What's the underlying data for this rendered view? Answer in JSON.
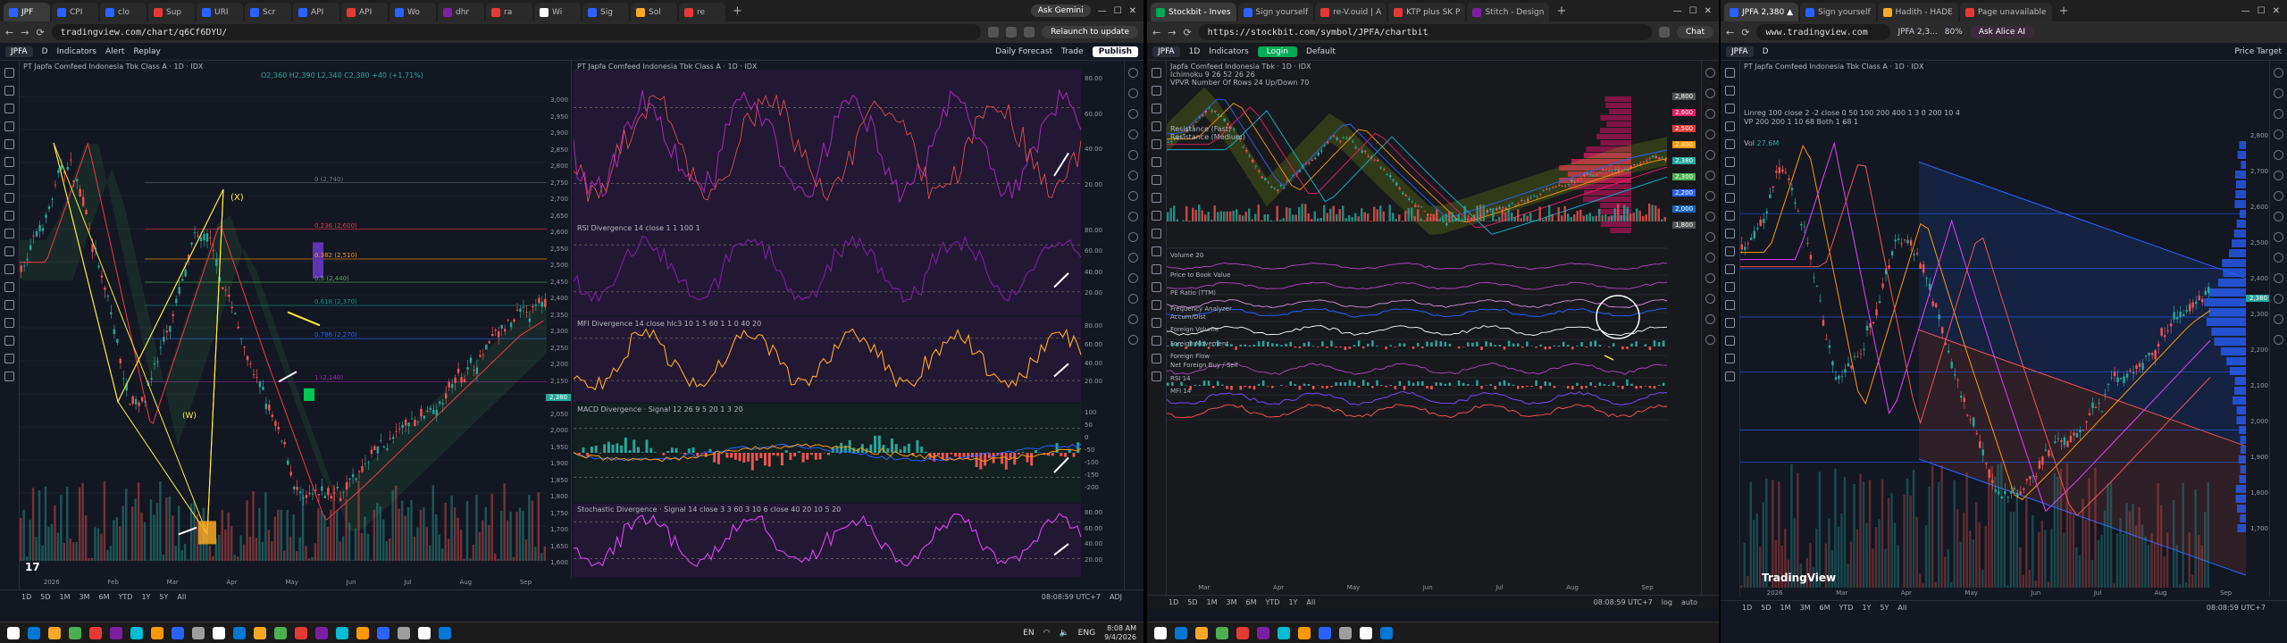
{
  "win1": {
    "tabs": [
      {
        "label": "JPF",
        "color": "#2962ff"
      },
      {
        "label": "CPI",
        "color": "#2962ff"
      },
      {
        "label": "clo",
        "color": "#2962ff"
      },
      {
        "label": "Sup",
        "color": "#e53935"
      },
      {
        "label": "URI",
        "color": "#2962ff"
      },
      {
        "label": "Scr",
        "color": "#2962ff"
      },
      {
        "label": "API",
        "color": "#2962ff"
      },
      {
        "label": "API",
        "color": "#e53935"
      },
      {
        "label": "Wo",
        "color": "#2962ff"
      },
      {
        "label": "dhr",
        "color": "#7b1fa2"
      },
      {
        "label": "ra",
        "color": "#e53935"
      },
      {
        "label": "Wi",
        "color": "#ffffff"
      },
      {
        "label": "Sig",
        "color": "#2962ff"
      },
      {
        "label": "Sol",
        "color": "#f9a825"
      },
      {
        "label": "re",
        "color": "#e53935"
      }
    ],
    "ask_gemini": "Ask Gemini",
    "url": "tradingview.com/chart/q6Cf6DYU/",
    "relaunch": "Relaunch to update",
    "symbol": "JPFA",
    "indicators": "Indicators",
    "alert": "Alert",
    "replay": "Replay",
    "daily_forecast": "Daily Forecast",
    "trade": "Trade",
    "publish": "Publish",
    "main_title": "PT Japfa Comfeed Indonesia Tbk Class A · 1D · IDX",
    "main_ohlc": "O2,360 H2,390 L2,340 C2,380 +40 (+1.71%)",
    "pane_title": "PT Japfa Comfeed Indonesia Tbk Class A · 1D · IDX",
    "rsi_div": "RSI Divergence 14 close 1 1 100 1",
    "mfi_div": "MFI Divergence 14 close hlc3 10 1 5 60 1 1 0 40 20",
    "macd_div": "MACD Divergence · Signal 12 26 9 5 20 1 3 20",
    "stoch_div": "Stochastic Divergence · Signal 14 close 3 3 60 3 10 6 close 40 20 10 5 20",
    "main_axis": [
      "3,000",
      "2,950",
      "2,900",
      "2,850",
      "2,800",
      "2,750",
      "2,700",
      "2,650",
      "2,600",
      "2,550",
      "2,500",
      "2,450",
      "2,400",
      "2,350",
      "2,300",
      "2,250",
      "2,200",
      "2,150",
      "2,100",
      "2,050",
      "2,000",
      "1,950",
      "1,900",
      "1,850",
      "1,800",
      "1,750",
      "1,700",
      "1,650",
      "1,600"
    ],
    "osc_axis": [
      "80.00",
      "60.00",
      "40.00",
      "20.00"
    ],
    "macd_axis": [
      "100",
      "50",
      "0",
      "-50",
      "-100",
      "-150",
      "-200"
    ],
    "months": [
      "2026",
      "Feb",
      "Mar",
      "Apr",
      "May",
      "Jun",
      "Jul",
      "Aug",
      "Sep"
    ],
    "fib_labels": [
      "0 (2,740)",
      "0.236 (2,600)",
      "0.382 (2,510)",
      "0.5 (2,440)",
      "0.618 (2,370)",
      "0.786 (2,270)",
      "1 (2,140)"
    ],
    "wave_labels": [
      "(X)",
      "(W)"
    ],
    "ranges": [
      "1D",
      "5D",
      "1M",
      "3M",
      "6M",
      "YTD",
      "1Y",
      "5Y",
      "All"
    ],
    "time_status": "08:08:59 UTC+7",
    "adj": "ADJ",
    "tv_logo": "TradingView"
  },
  "win2": {
    "tabs": [
      {
        "label": "Stockbit - Inves",
        "color": "#00ab55"
      },
      {
        "label": "Sign yourself",
        "color": "#2962ff"
      },
      {
        "label": "re-V.ouid | A",
        "color": "#e53935"
      },
      {
        "label": "KTP plus SK P",
        "color": "#e53935"
      },
      {
        "label": "Stitch - Design",
        "color": "#7b1fa2"
      }
    ],
    "url": "https://stockbit.com/symbol/JPFA/chartbit",
    "chat": "Chat",
    "symbol": "JPFA",
    "indicators": "Indicators",
    "login": "Login",
    "default": "Default",
    "chart_title": "Japfa Comfeed Indonesia Tbk · 1D · IDX",
    "ichimoku": "Ichimoku 9 26 52 26 26",
    "vpvr": "VPVR Number Of Rows 24 Up/Down 70",
    "indicators_list": [
      "Volume 20",
      "Price to Book Value",
      "PE Ratio (TTM)",
      "Frequency Analyzer",
      "Accum/Dist",
      "Foreign Volume",
      "Foreign Movement",
      "Foreign Flow",
      "Net Foreign Buy / Sell",
      "RSI 14",
      "MFI 14"
    ],
    "overlays": [
      "Resistance (Fast)",
      "Resistance (Medium)"
    ],
    "price_tags": [
      "2,800",
      "2,600",
      "2,500",
      "2,400",
      "2,380",
      "2,300",
      "2,200",
      "2,000",
      "1,800"
    ],
    "months": [
      "Mar",
      "Apr",
      "May",
      "Jun",
      "Jul",
      "Aug",
      "Sep"
    ],
    "ranges": [
      "1D",
      "5D",
      "1M",
      "3M",
      "6M",
      "YTD",
      "1Y",
      "All"
    ],
    "time_status": "08:08:59 UTC+7",
    "log": "log",
    "auto": "auto"
  },
  "win3": {
    "tabs": [
      {
        "label": "JPFA 2,380 ▲",
        "color": "#2962ff"
      },
      {
        "label": "Sign yourself",
        "color": "#2962ff"
      },
      {
        "label": "Hadith - HADE",
        "color": "#f9a825"
      },
      {
        "label": "Page unavailable",
        "color": "#e53935"
      }
    ],
    "url": "www.tradingview.com",
    "page_title": "JPFA 2,3...",
    "zoom": "80%",
    "ask_alice": "Ask Alice AI",
    "symbol": "JPFA",
    "price_target": "Price Target",
    "chart_title": "PT Japfa Comfeed Indonesia Tbk Class A · 1D · IDX",
    "line1": "Linreg 100 close 2 -2 close 0 50 100 200 400 1 3 0 200 10 4",
    "line2": "VP 200 200 1 10 68 Both 1 68 1",
    "vol_label": "Vol",
    "vol_value": "27.6M",
    "axis": [
      "2,800",
      "2,700",
      "2,600",
      "2,500",
      "2,400",
      "2,300",
      "2,200",
      "2,100",
      "2,000",
      "1,900",
      "1,800",
      "1,700"
    ],
    "months": [
      "2026",
      "Mar",
      "Apr",
      "May",
      "Jun",
      "Jul",
      "Aug",
      "Sep"
    ],
    "ranges": [
      "1D",
      "5D",
      "1M",
      "3M",
      "6M",
      "YTD",
      "1Y",
      "5Y",
      "All"
    ],
    "time_status": "08:08:59 UTC+7",
    "tv_logo": "TradingView"
  },
  "taskbar": {
    "lang": "EN",
    "kb": "ENG",
    "time": "8:08 AM",
    "date": "9/4/2026"
  },
  "colors": {
    "bg": "#131722",
    "candle_up": "#26a69a",
    "candle_down": "#ef5350",
    "purple": "#9c27b0",
    "yellow": "#ffeb3b"
  }
}
